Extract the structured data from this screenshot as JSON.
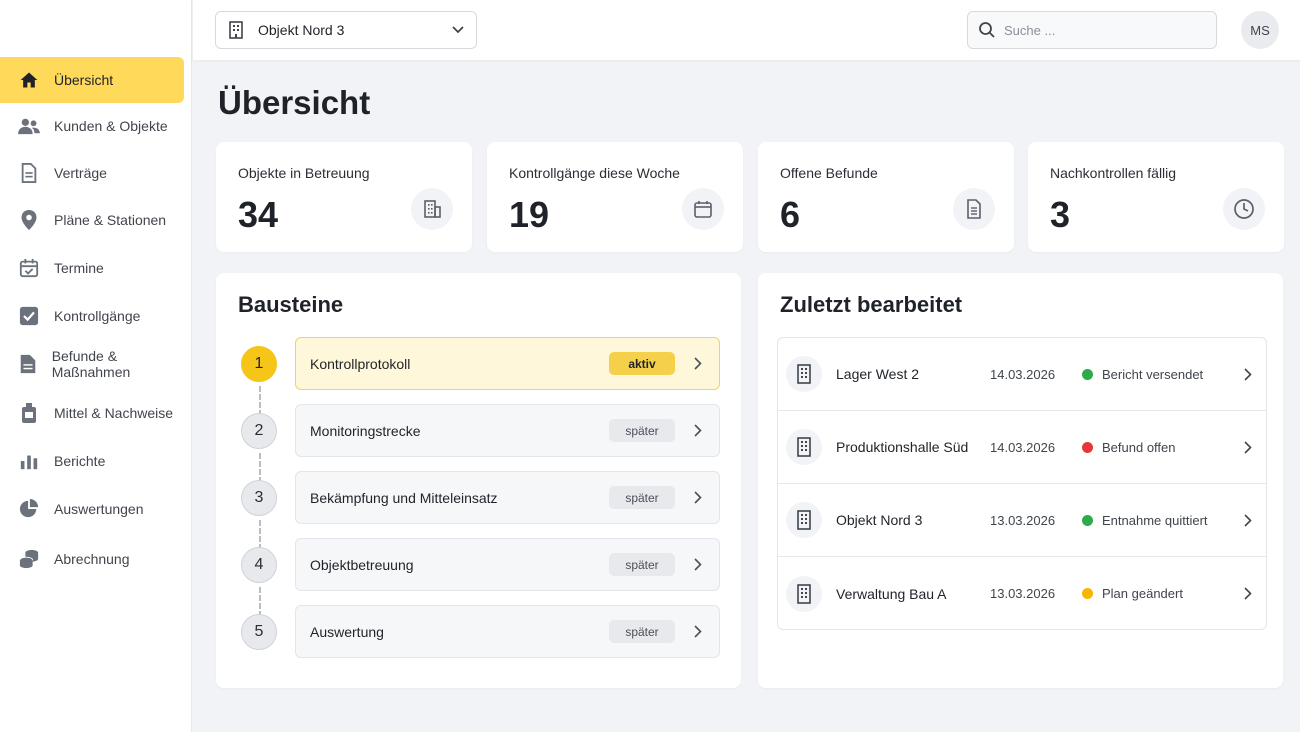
{
  "sidebar": {
    "items": [
      {
        "label": "Übersicht",
        "icon": "home-icon",
        "active": true
      },
      {
        "label": "Kunden & Objekte",
        "icon": "users-icon"
      },
      {
        "label": "Verträge",
        "icon": "document-icon"
      },
      {
        "label": "Pläne & Stationen",
        "icon": "map-pin-icon"
      },
      {
        "label": "Termine",
        "icon": "calendar-check-icon"
      },
      {
        "label": "Kontrollgänge",
        "icon": "checkbox-icon"
      },
      {
        "label": "Befunde & Maßnahmen",
        "icon": "file-icon"
      },
      {
        "label": "Mittel & Nachweise",
        "icon": "bottle-icon"
      },
      {
        "label": "Berichte",
        "icon": "bar-chart-icon"
      },
      {
        "label": "Auswertungen",
        "icon": "pie-chart-icon"
      },
      {
        "label": "Abrechnung",
        "icon": "coins-icon"
      }
    ]
  },
  "topbar": {
    "object_select": "Objekt Nord 3",
    "search_placeholder": "Suche ...",
    "avatar_initials": "MS"
  },
  "page": {
    "title": "Übersicht"
  },
  "stats": [
    {
      "label": "Objekte in Betreuung",
      "value": "34",
      "icon": "building-icon"
    },
    {
      "label": "Kontrollgänge diese Woche",
      "value": "19",
      "icon": "calendar-icon"
    },
    {
      "label": "Offene Befunde",
      "value": "6",
      "icon": "report-icon"
    },
    {
      "label": "Nachkontrollen fällig",
      "value": "3",
      "icon": "clock-icon"
    }
  ],
  "bausteine": {
    "title": "Bausteine",
    "steps": [
      {
        "num": "1",
        "label": "Kontrollprotokoll",
        "badge": "aktiv",
        "active": true
      },
      {
        "num": "2",
        "label": "Monitoringstrecke",
        "badge": "später"
      },
      {
        "num": "3",
        "label": "Bekämpfung und Mitteleinsatz",
        "badge": "später"
      },
      {
        "num": "4",
        "label": "Objektbetreuung",
        "badge": "später"
      },
      {
        "num": "5",
        "label": "Auswertung",
        "badge": "später"
      }
    ]
  },
  "recent": {
    "title": "Zuletzt bearbeitet",
    "rows": [
      {
        "name": "Lager West 2",
        "date": "14.03.2026",
        "status": "Bericht versendet",
        "status_color": "#2eaa4a"
      },
      {
        "name": "Produktionshalle Süd",
        "date": "14.03.2026",
        "status": "Befund offen",
        "status_color": "#e53935"
      },
      {
        "name": "Objekt Nord 3",
        "date": "13.03.2026",
        "status": "Entnahme quittiert",
        "status_color": "#2eaa4a"
      },
      {
        "name": "Verwaltung Bau A",
        "date": "13.03.2026",
        "status": "Plan geändert",
        "status_color": "#f5b800"
      }
    ]
  }
}
